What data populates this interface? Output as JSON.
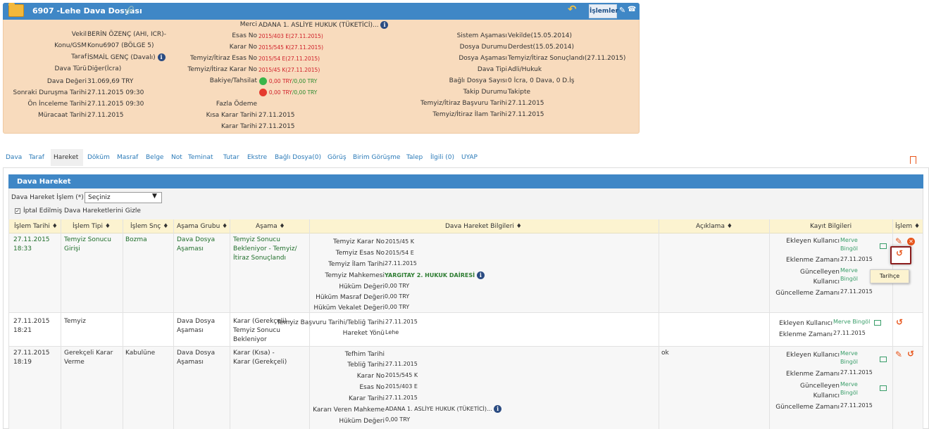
{
  "header": {
    "title": "6907 -Lehe Dava Dosyası",
    "islemler_label": "İşlemler",
    "col1": [
      {
        "label": "Vekil",
        "value": "BERİN ÖZENÇ (AHI, ICR)-"
      },
      {
        "label": "Konu/GSM",
        "value": "Konu6907 (BÖLGE 5)"
      },
      {
        "label": "Taraf",
        "value": "İSMAİL GENÇ (Davalı)"
      },
      {
        "label": "Dava Türü",
        "value": "Diğer(İcra)"
      },
      {
        "label": "Dava Değeri",
        "value": "31.069,69 TRY"
      },
      {
        "label": "Sonraki Duruşma Tarihi",
        "value": "27.11.2015 09:30"
      },
      {
        "label": "Ön İnceleme Tarihi",
        "value": "27.11.2015 09:30"
      },
      {
        "label": "Müracaat Tarihi",
        "value": "27.11.2015"
      }
    ],
    "col2": {
      "merci_label": "Merci",
      "merci_value": "ADANA 1. ASLİYE HUKUK (TÜKETİCİ)...",
      "esas_label": "Esas No",
      "esas_value": "2015/403 E(27.11.2015)",
      "karar_label": "Karar No",
      "karar_value": "2015/545 K(27.11.2015)",
      "temyiz_esas_label": "Temyiz/İtiraz Esas No",
      "temyiz_esas_value": "2015/54 E(27.11.2015)",
      "temyiz_karar_label": "Temyiz/İtiraz Karar No",
      "temyiz_karar_value": "2015/45 K(27.11.2015)",
      "bakiye_label": "Bakiye/Tahsilat",
      "bakiye_up": "0,00 TRY",
      "bakiye_up2": "0,00 TRY",
      "bakiye_down": "0,00 TRY",
      "bakiye_down2": "0,00 TRY",
      "fazla_label": "Fazla Ödeme",
      "kisa_label": "Kısa Karar Tarihi",
      "kisa_value": "27.11.2015",
      "karar_tarihi_label": "Karar Tarihi",
      "karar_tarihi_value": "27.11.2015"
    },
    "col3": [
      {
        "label": "Sistem Aşaması",
        "value": "Vekilde(15.05.2014)"
      },
      {
        "label": "Dosya Durumu",
        "value": "Derdest(15.05.2014)"
      },
      {
        "label": "Dosya Aşaması",
        "value": "Temyiz/İtiraz Sonuçlandı(27.11.2015)"
      },
      {
        "label": "Dava Tipi",
        "value": "Adli/Hukuk"
      },
      {
        "label": "Bağlı Dosya Sayısı",
        "value": "0 İcra, 0 Dava, 0 D.İş"
      },
      {
        "label": "Takip Durumu",
        "value": "Takipte"
      },
      {
        "label": "Temyiz/İtiraz Başvuru Tarihi",
        "value": "27.11.2015"
      },
      {
        "label": "Temyiz/İtiraz İlam Tarihi",
        "value": "27.11.2015"
      }
    ]
  },
  "tabs": [
    "Dava",
    "Taraf",
    "Hareket",
    "Döküm",
    "Masraf",
    "Belge",
    "Not",
    "Teminat",
    "Tutar",
    "Ekstre",
    "Bağlı Dosya(0)",
    "Görüş",
    "Birim Görüşme",
    "Talep",
    "İlgili (0)",
    "UYAP"
  ],
  "section": {
    "title": "Dava Hareket",
    "islem_label": "Dava Hareket İşlem (*)",
    "select_value": "Seçiniz",
    "checkbox_label": "İptal Edilmiş Dava Hareketlerini Gizle"
  },
  "columns": [
    "İşlem Tarihi",
    "İşlem Tipi",
    "İşlem Snç",
    "Aşama Grubu",
    "Aşama",
    "Dava Hareket Bilgileri",
    "Açıklama",
    "Kayıt Bilgileri",
    "İşlem"
  ],
  "rows": [
    {
      "tarih": "27.11.2015",
      "saat": "18:33",
      "tip": "Temyiz Sonucu Girişi",
      "snc": "Bozma",
      "grup": "Dava Dosya Aşaması",
      "asama": "Temyiz Sonucu Bekleniyor - Temyiz/İtiraz Sonuçlandı",
      "details": [
        {
          "label": "Temyiz Karar No",
          "value": "2015/45 K"
        },
        {
          "label": "Temyiz Esas No",
          "value": "2015/54 E"
        },
        {
          "label": "Temyiz İlam Tarihi",
          "value": "27.11.2015"
        },
        {
          "label": "Temyiz Mahkemesi",
          "value": "YARGITAY 2. HUKUK DAİRESİ"
        },
        {
          "label": "Hüküm Değeri",
          "value": "0,00 TRY"
        },
        {
          "label": "Hüküm Masraf Değeri",
          "value": "0,00 TRY"
        },
        {
          "label": "Hüküm Vekalet Değeri",
          "value": "0,00 TRY"
        }
      ],
      "aciklama": "",
      "ekleyen_label": "Ekleyen Kullanıcı",
      "ekleyen": "Merve Bingöl",
      "eklenme_label": "Eklenme Zamanı",
      "eklenme": "27.11.2015",
      "guncelleyen_label": "Güncelleyen Kullanıcı",
      "guncelleyen": "Merve Bingöl",
      "guncelleme_label": "Güncelleme Zamanı",
      "guncelleme": "27.11.2015"
    },
    {
      "tarih": "27.11.2015",
      "saat": "18:21",
      "tip": "Temyiz",
      "snc": "",
      "grup": "Dava Dosya Aşaması",
      "asama": "Karar (Gerekçeli) - Temyiz Sonucu Bekleniyor",
      "details": [
        {
          "label": "Temyiz Başvuru Tarihi/Tebliğ Tarihi",
          "value": "27.11.2015"
        },
        {
          "label": "Hareket Yönü",
          "value": "Lehe"
        }
      ],
      "aciklama": "",
      "ekleyen_label": "Ekleyen Kullanıcı",
      "ekleyen": "Merve Bingöl",
      "eklenme_label": "Eklenme Zamanı",
      "eklenme": "27.11.2015"
    },
    {
      "tarih": "27.11.2015",
      "saat": "18:19",
      "tip": "Gerekçeli Karar Verme",
      "snc": "Kabulüne",
      "grup": "Dava Dosya Aşaması",
      "asama": "Karar (Kısa) - Karar (Gerekçeli)",
      "details": [
        {
          "label": "Tefhim Tarihi",
          "value": ""
        },
        {
          "label": "Tebliğ Tarihi",
          "value": "27.11.2015"
        },
        {
          "label": "Karar No",
          "value": "2015/545 K"
        },
        {
          "label": "Esas No",
          "value": "2015/403 E"
        },
        {
          "label": "Karar Tarihi",
          "value": "27.11.2015"
        },
        {
          "label": "Kararı Veren Mahkeme",
          "value": "ADANA 1. ASLİYE HUKUK (TÜKETİCİ)..."
        },
        {
          "label": "Hüküm Değeri",
          "value": "0,00 TRY"
        }
      ],
      "aciklama": "ok",
      "ekleyen_label": "Ekleyen Kullanıcı",
      "ekleyen": "Merve Bingöl",
      "eklenme_label": "Eklenme Zamanı",
      "eklenme": "27.11.2015",
      "guncelleyen_label": "Güncelleyen Kullanıcı",
      "guncelleyen": "Merve Bingöl",
      "guncelleme_label": "Güncelleme Zamanı",
      "guncelleme": "27.11.2015"
    }
  ],
  "tooltip": "Tarihçe",
  "colors": {
    "accent": "#3f87c6",
    "panel": "#f8dbbd",
    "link": "#2a7ab8",
    "action": "#e8561c"
  },
  "icons": [
    "folder-icon",
    "link-icon",
    "back-arrow-icon",
    "edit-icon",
    "phone-icon",
    "info-icon",
    "bookmark-icon",
    "history-icon",
    "pencil-icon",
    "cancel-icon",
    "mail-icon"
  ]
}
